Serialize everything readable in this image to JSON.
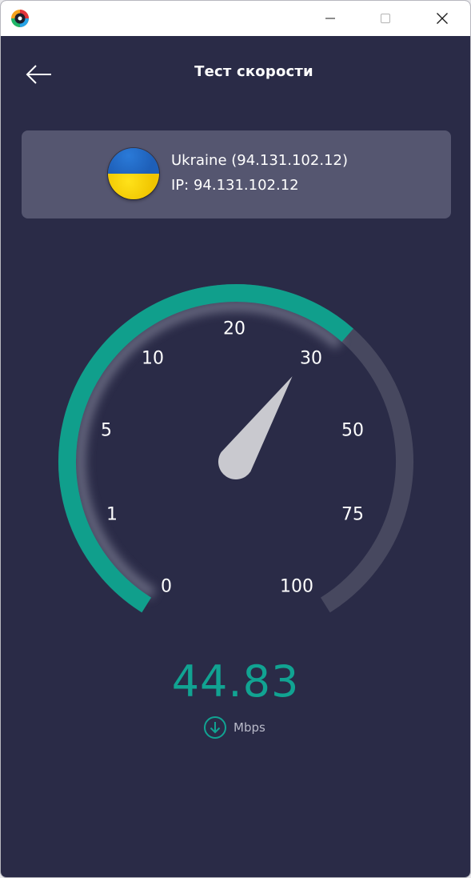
{
  "window": {
    "minimize_icon": "minimize-icon",
    "maximize_icon": "maximize-icon",
    "close_icon": "close-icon"
  },
  "header": {
    "title": "Тест скорости",
    "back_icon": "arrow-left-icon"
  },
  "server": {
    "flag_icon": "ukraine-flag-icon",
    "name": "Ukraine (94.131.102.12)",
    "ip": "IP: 94.131.102.12"
  },
  "gauge": {
    "ticks": [
      "0",
      "1",
      "5",
      "10",
      "20",
      "30",
      "50",
      "75",
      "100"
    ],
    "fill_fraction": 0.64,
    "colors": {
      "accent": "#109f8c",
      "track": "#47485f",
      "background": "#2a2b47",
      "needle": "#c9c9cf"
    }
  },
  "result": {
    "value": "44.83",
    "unit": "Mbps",
    "direction_icon": "download-arrow-icon"
  }
}
